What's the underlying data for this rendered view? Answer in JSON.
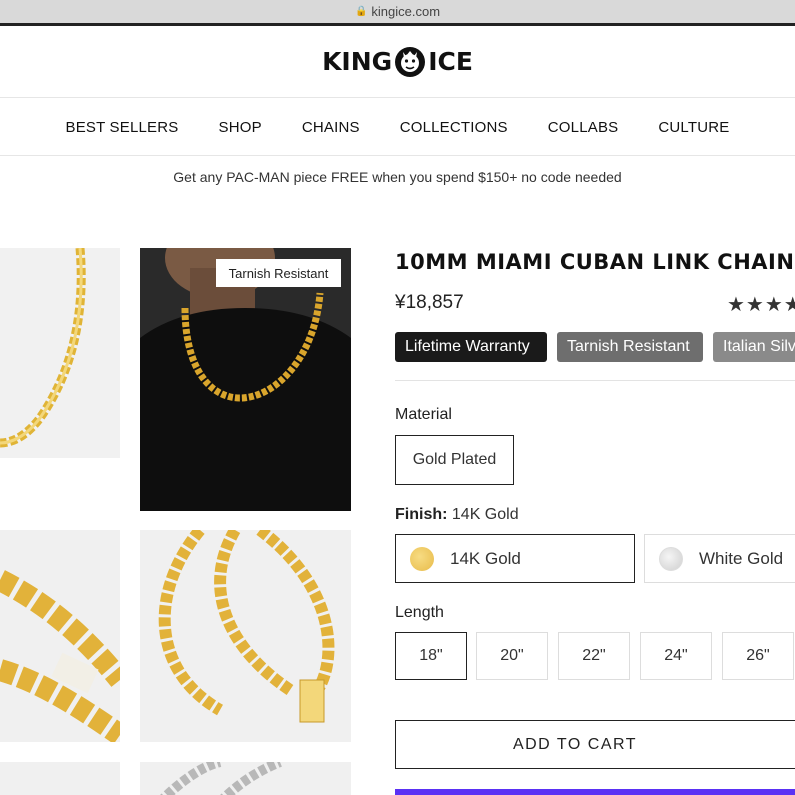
{
  "browser": {
    "url": "kingice.com"
  },
  "brand": {
    "logo_text_left": "KING",
    "logo_text_right": "ICE"
  },
  "nav": {
    "items": [
      "BEST SELLERS",
      "SHOP",
      "CHAINS",
      "COLLECTIONS",
      "COLLABS",
      "CULTURE"
    ]
  },
  "promo": "Get any PAC-MAN piece FREE when you spend $150+ no code needed",
  "gallery": {
    "badge": "Tarnish Resistant"
  },
  "product": {
    "title": "10MM MIAMI CUBAN LINK CHAIN",
    "price": "¥18,857",
    "rating_stars": "★★★★",
    "features": [
      "Lifetime Warranty",
      "Tarnish Resistant",
      "Italian Silver"
    ]
  },
  "material": {
    "label": "Material",
    "options": [
      "Gold Plated"
    ]
  },
  "finish": {
    "label": "Finish:",
    "selected": "14K Gold",
    "options": [
      "14K Gold",
      "White Gold"
    ]
  },
  "length": {
    "label": "Length",
    "options": [
      "18\"",
      "20\"",
      "22\"",
      "24\"",
      "26\""
    ]
  },
  "actions": {
    "add_to_cart": "ADD TO CART"
  },
  "colors": {
    "shop_pay": "#5a31f4",
    "gold_swatch": "#f0c65c"
  }
}
